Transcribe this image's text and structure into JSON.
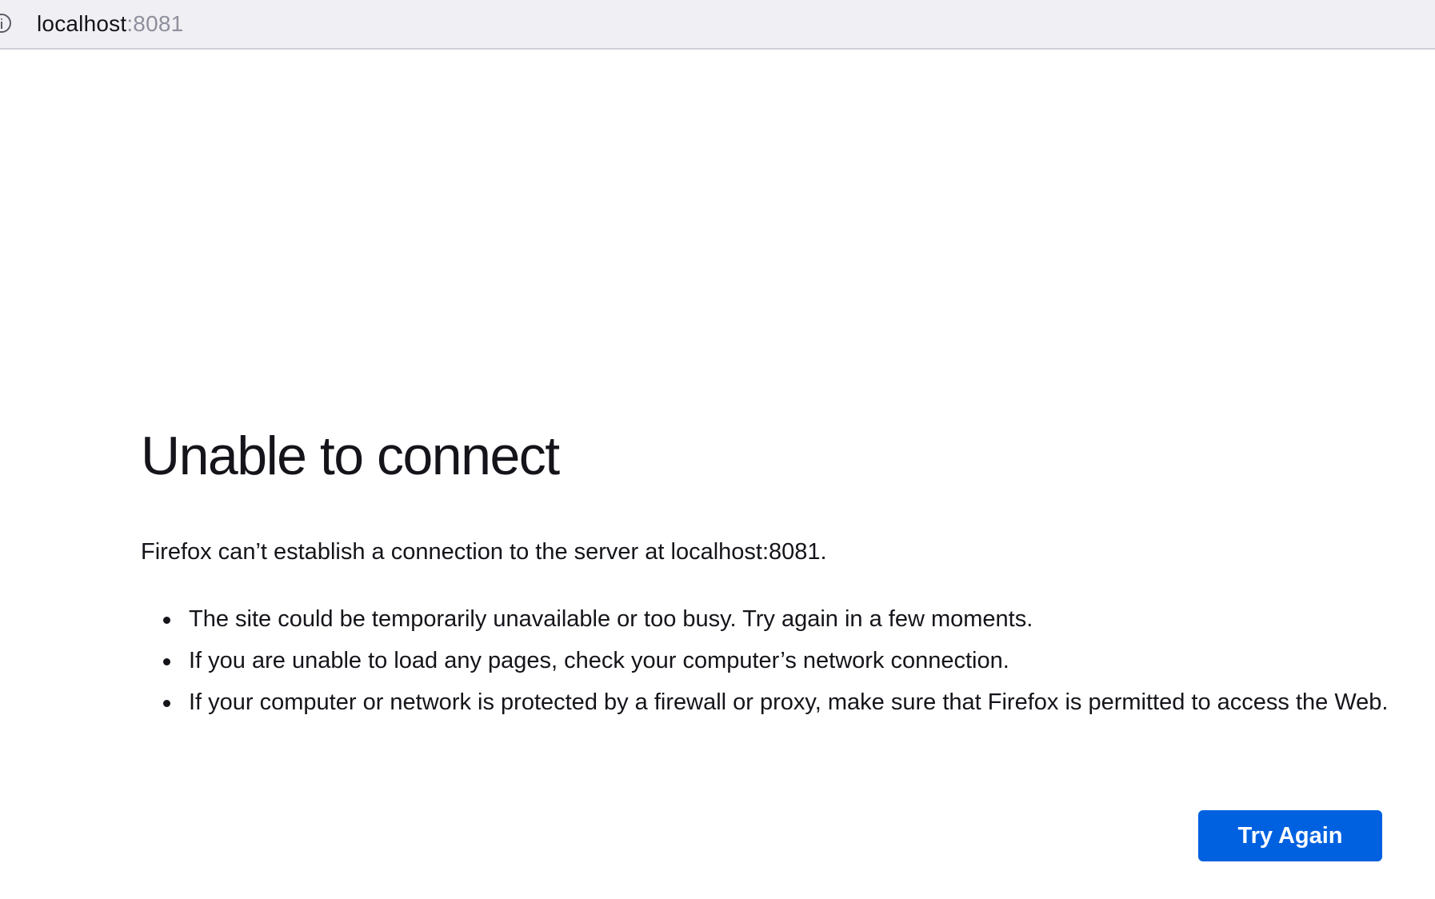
{
  "urlbar": {
    "icon": "info-icon",
    "host": "localhost",
    "port": ":8081"
  },
  "error": {
    "title": "Unable to connect",
    "description": "Firefox can’t establish a connection to the server at localhost:8081.",
    "reasons": [
      "The site could be temporarily unavailable or too busy. Try again in a few moments.",
      "If you are unable to load any pages, check your computer’s network connection.",
      "If your computer or network is protected by a firewall or proxy, make sure that Firefox is permitted to access the Web."
    ],
    "button_label": "Try Again"
  },
  "colors": {
    "accent": "#0061e0",
    "urlbar_bg": "#f0f0f4",
    "text": "#15141a",
    "muted": "#8f8f9d"
  }
}
